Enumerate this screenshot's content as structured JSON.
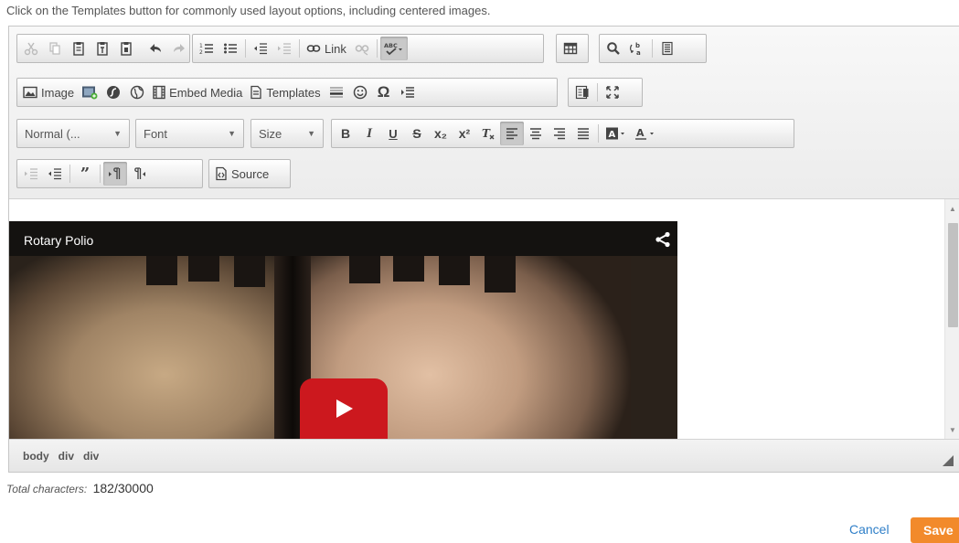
{
  "hint": "Click on the Templates button for commonly used layout options, including centered images.",
  "toolbar": {
    "link_label": "Link",
    "image_label": "Image",
    "embed_media_label": "Embed Media",
    "templates_label": "Templates",
    "format_select": "Normal (...",
    "font_select": "Font",
    "size_select": "Size",
    "bold": "B",
    "italic": "I",
    "underline": "U",
    "strike": "S",
    "subscript": "x₂",
    "superscript": "x²",
    "source_label": "Source"
  },
  "content": {
    "video_title": "Rotary Polio"
  },
  "pathbar": [
    "body",
    "div",
    "div"
  ],
  "footer": {
    "chars_label": "Total characters:",
    "chars_value": "182/30000",
    "cancel": "Cancel",
    "save": "Save"
  },
  "colors": {
    "save_bg": "#f28a2b",
    "cancel_link": "#2f7fc8",
    "play_button": "#cc181e"
  }
}
